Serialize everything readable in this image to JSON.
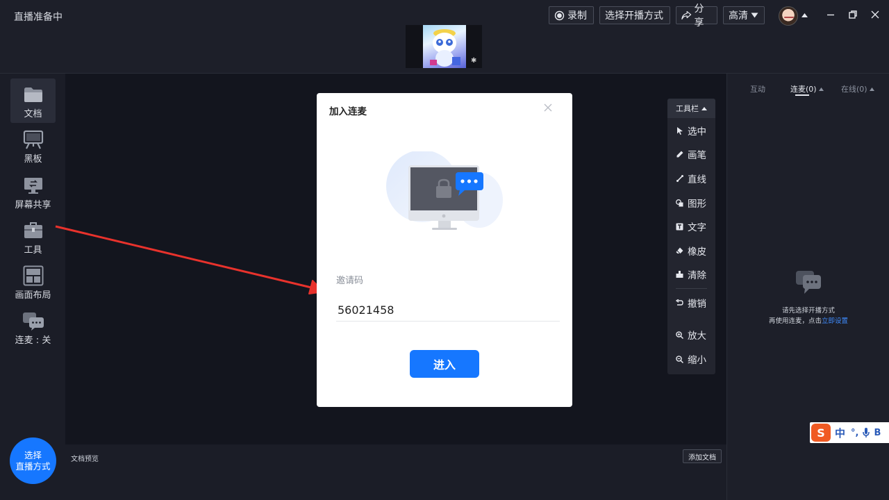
{
  "app": {
    "title": "直播准备中"
  },
  "header": {
    "record_label": "录制",
    "broadcast_mode_label": "选择开播方式",
    "share_label": "分享",
    "quality_label": "高清"
  },
  "sidebar": {
    "items": [
      {
        "label": "文档",
        "icon": "folder-icon"
      },
      {
        "label": "黑板",
        "icon": "blackboard-icon"
      },
      {
        "label": "屏幕共享",
        "icon": "screen-share-icon"
      },
      {
        "label": "工具",
        "icon": "toolbox-icon"
      },
      {
        "label": "画面布局",
        "icon": "layout-icon"
      },
      {
        "label": "连麦 : 关",
        "icon": "chat-bubbles-icon"
      }
    ],
    "live_button": {
      "line1": "选择",
      "line2": "直播方式"
    }
  },
  "stage": {
    "doc_preview_label": "文档预览",
    "add_doc_label": "添加文档"
  },
  "toolbar": {
    "header_label": "工具栏",
    "tools": [
      {
        "label": "选中",
        "icon": "cursor-icon"
      },
      {
        "label": "画笔",
        "icon": "pen-icon"
      },
      {
        "label": "直线",
        "icon": "line-icon"
      },
      {
        "label": "图形",
        "icon": "shape-icon"
      },
      {
        "label": "文字",
        "icon": "text-icon"
      },
      {
        "label": "橡皮",
        "icon": "eraser-icon"
      },
      {
        "label": "清除",
        "icon": "clear-icon"
      },
      {
        "label": "撤销",
        "icon": "undo-icon"
      },
      {
        "label": "放大",
        "icon": "zoom-in-icon"
      },
      {
        "label": "缩小",
        "icon": "zoom-out-icon"
      }
    ]
  },
  "right_panel": {
    "tabs": [
      {
        "label": "互动"
      },
      {
        "label": "连麦(0)"
      },
      {
        "label": "在线(0)"
      }
    ],
    "active_tab": "连麦(0)",
    "empty_line1": "请先选择开播方式",
    "empty_line2_prefix": "再使用连麦，点击",
    "empty_link": "立即设置"
  },
  "modal": {
    "title": "加入连麦",
    "invite_label": "邀请码",
    "invite_value": "56021458",
    "enter_label": "进入"
  },
  "ime": {
    "logo": "S",
    "mode": "中",
    "punct": "°,",
    "extra": "B"
  },
  "colors": {
    "accent": "#1677ff",
    "arrow": "#e8322c",
    "link": "#3f8cff"
  }
}
